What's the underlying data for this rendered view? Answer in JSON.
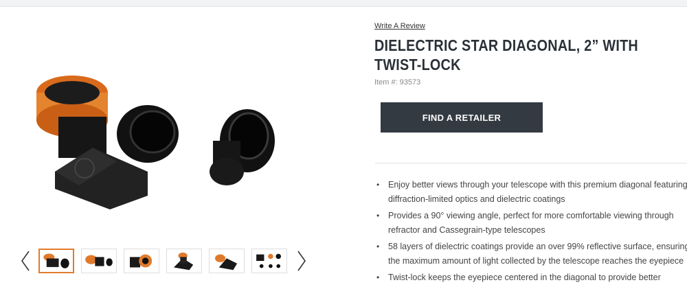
{
  "product": {
    "review_link": "Write A Review",
    "title": "DIELECTRIC STAR DIAGONAL, 2” WITH TWIST-LOCK",
    "item_label": "Item #:",
    "item_number": "93573",
    "retailer_button": "FIND A RETAILER"
  },
  "features": [
    "Enjoy better views through your telescope with this premium diagonal featuring diffraction-limited optics and dielectric coatings",
    "Provides a 90° viewing angle, perfect for more comfortable viewing through refractor and Cassegrain-type telescopes",
    "58 layers of dielectric coatings provide an over 99% reflective surface, ensuring the maximum amount of light collected by the telescope reaches the eyepiece",
    "Twist-lock keeps the eyepiece centered in the diagonal to provide better"
  ],
  "gallery": {
    "icons": {
      "prev": "chevron-left-icon",
      "next": "chevron-right-icon"
    },
    "accent_color": "#e07a2b",
    "thumb_count": 6,
    "active_thumb": 1
  },
  "colors": {
    "button": "#333a42",
    "title": "#2b3138",
    "orange": "#e07a2b"
  }
}
